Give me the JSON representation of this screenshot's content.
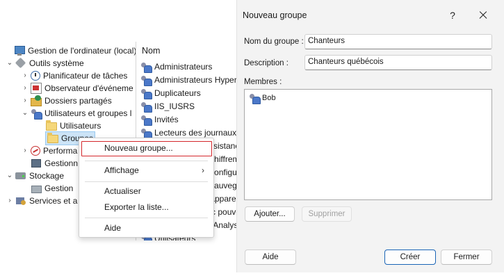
{
  "mmc": {
    "tree": [
      {
        "label": "Gestion de l'ordinateur (local)",
        "icon": "computer-icon",
        "chevron": ""
      },
      {
        "label": "Outils système",
        "icon": "tools-icon",
        "chevron": "v"
      },
      {
        "label": "Planificateur de tâches",
        "icon": "clock-icon",
        "chevron": ">"
      },
      {
        "label": "Observateur d'événeme",
        "icon": "event-log-icon",
        "chevron": ">"
      },
      {
        "label": "Dossiers partagés",
        "icon": "shared-folder-icon",
        "chevron": ">"
      },
      {
        "label": "Utilisateurs et groupes l",
        "icon": "users-icon",
        "chevron": "v"
      },
      {
        "label": "Utilisateurs",
        "icon": "folder-icon",
        "chevron": ""
      },
      {
        "label": "Groupes",
        "icon": "folder-icon",
        "chevron": "",
        "selected": true
      },
      {
        "label": "Performa",
        "icon": "performance-icon",
        "chevron": ">"
      },
      {
        "label": "Gestionn",
        "icon": "device-manager-icon",
        "chevron": ""
      },
      {
        "label": "Stockage",
        "icon": "storage-icon",
        "chevron": "v"
      },
      {
        "label": "Gestion",
        "icon": "disk-icon",
        "chevron": ""
      },
      {
        "label": "Services et a",
        "icon": "services-icon",
        "chevron": ">"
      }
    ],
    "list_header": "Nom",
    "list_items": [
      "Administrateurs",
      "Administrateurs Hyper",
      "Duplicateurs",
      "IIS_IUSRS",
      "Invités",
      "Lecteurs des journaux",
      "Opérateurs d'assistance",
      "Opérateurs de chiffrement",
      "Opérateurs de configuration",
      "Opérateurs de sauvegarde",
      "Propriétaires d'appareils",
      "Utilisateurs avec pouvoir",
      "Utilisateurs de l'Analyseur",
      "Utilisateurs du Bureau à distance",
      "Utilisateurs"
    ]
  },
  "context_menu": {
    "items": [
      {
        "label": "Nouveau groupe...",
        "highlighted": true
      },
      {
        "label": "Affichage",
        "submenu": true
      },
      {
        "label": "Actualiser"
      },
      {
        "label": "Exporter la liste..."
      },
      {
        "label": "Aide"
      }
    ],
    "submenu_arrow": "›"
  },
  "dialog": {
    "title": "Nouveau groupe",
    "help_glyph": "?",
    "group_name_label": "Nom du groupe :",
    "group_name_value": "Chanteurs",
    "description_label": "Description :",
    "description_value": "Chanteurs québécois",
    "members_label": "Membres :",
    "members": [
      "Bob"
    ],
    "add_button": "Ajouter...",
    "remove_button": "Supprimer",
    "help_button": "Aide",
    "create_button": "Créer",
    "close_button": "Fermer",
    "accent_color": "#1a64b6"
  },
  "colors": {
    "selection": "#cce4f7",
    "highlight_border": "#d4262b"
  }
}
